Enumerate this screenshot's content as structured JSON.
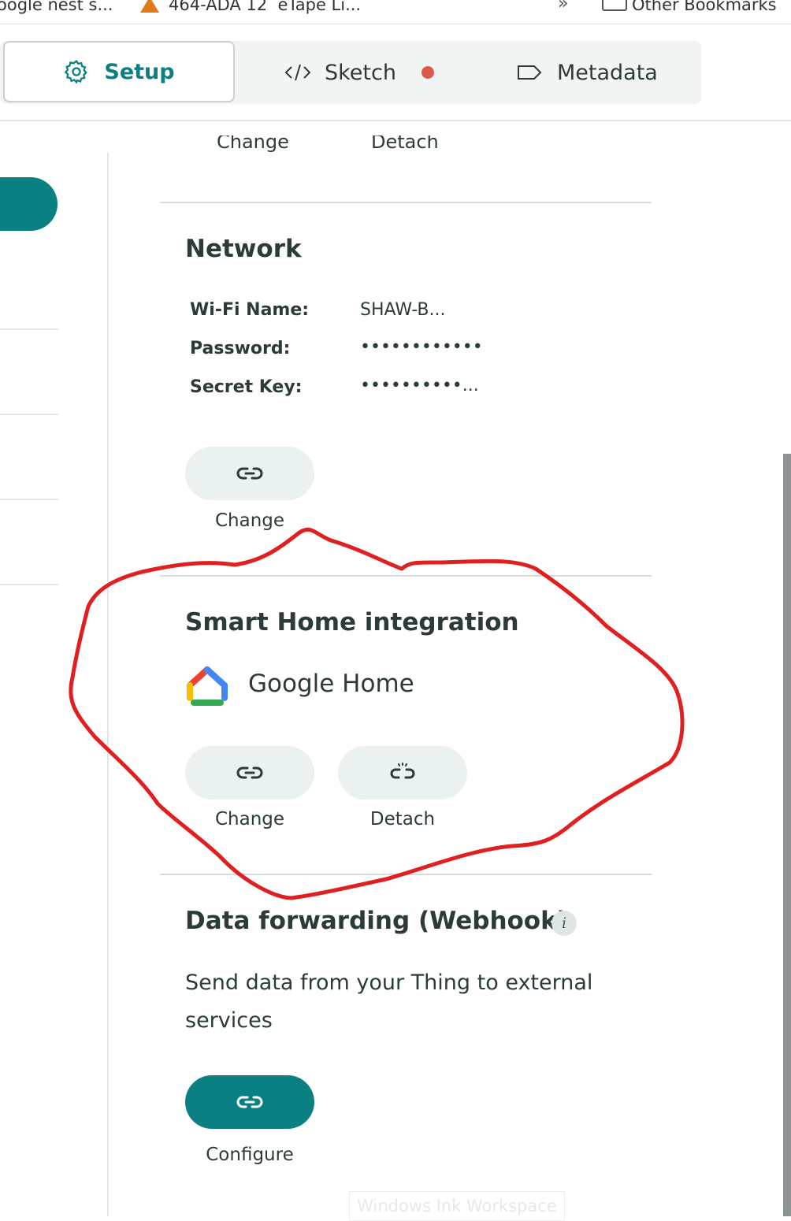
{
  "bookmarks": {
    "items": [
      "oogle nest s...",
      "464-ADA 12  eTape Li...",
      "Other Bookmarks"
    ]
  },
  "tabs": [
    {
      "label": "Setup",
      "icon": "gear-icon",
      "active": true
    },
    {
      "label": "Sketch",
      "icon": "code-icon",
      "has_dot": true
    },
    {
      "label": "Metadata",
      "icon": "tag-icon"
    }
  ],
  "top_section": {
    "change_label": "Change",
    "detach_label": "Detach"
  },
  "network": {
    "title": "Network",
    "fields": [
      {
        "label": "Wi-Fi Name:",
        "value": "SHAW-B..."
      },
      {
        "label": "Password:",
        "value": "••••••••••••"
      },
      {
        "label": "Secret Key:",
        "value": "••••••••••..."
      }
    ],
    "change_label": "Change"
  },
  "smart_home": {
    "title": "Smart Home integration",
    "provider": "Google Home",
    "change_label": "Change",
    "detach_label": "Detach"
  },
  "webhook": {
    "title": "Data forwarding (Webhook)",
    "info_glyph": "i",
    "description": "Send data from your Thing to external services",
    "configure_label": "Configure"
  },
  "overlay": {
    "ink_text": "Windows Ink Workspace"
  },
  "colors": {
    "accent": "#0a8083",
    "annotation": "#e02020",
    "sketch_dot": "#db5b4a"
  }
}
